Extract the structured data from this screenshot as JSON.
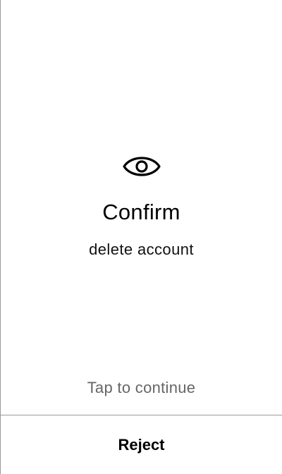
{
  "prompt": {
    "icon": "eye-icon",
    "title": "Confirm",
    "message": "delete account",
    "hint": "Tap to continue"
  },
  "actions": {
    "reject_label": "Reject"
  },
  "colors": {
    "background": "#ffffff",
    "text": "#000000",
    "hint_text": "#666666",
    "divider": "#9a9a9a"
  }
}
